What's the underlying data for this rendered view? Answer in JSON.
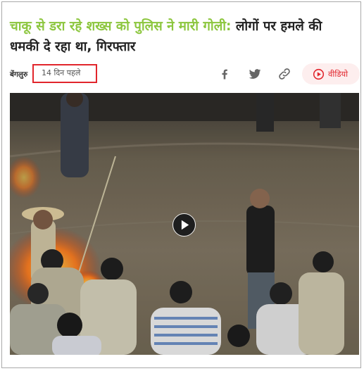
{
  "headline": {
    "highlight": "चाकू से डरा रहे शख्स को पुलिस ने मारी गोली:",
    "rest": " लोगों पर हमले की धमकी दे रहा था, गिरफ्तार"
  },
  "meta": {
    "location": "बेंगलुरु",
    "time_ago": "14 दिन पहले"
  },
  "share": {
    "icons": [
      "facebook-icon",
      "twitter-icon",
      "link-icon"
    ]
  },
  "video_button": {
    "label": "वीडियो",
    "icon": "play-circle-icon"
  },
  "media": {
    "kind": "video-thumbnail",
    "play_icon": "play-icon"
  },
  "colors": {
    "headline_accent": "#8cc63e",
    "highlight_border": "#e1252c",
    "video_accent": "#e1252c",
    "video_bg": "#fdeeee",
    "icon_gray": "#666666"
  }
}
